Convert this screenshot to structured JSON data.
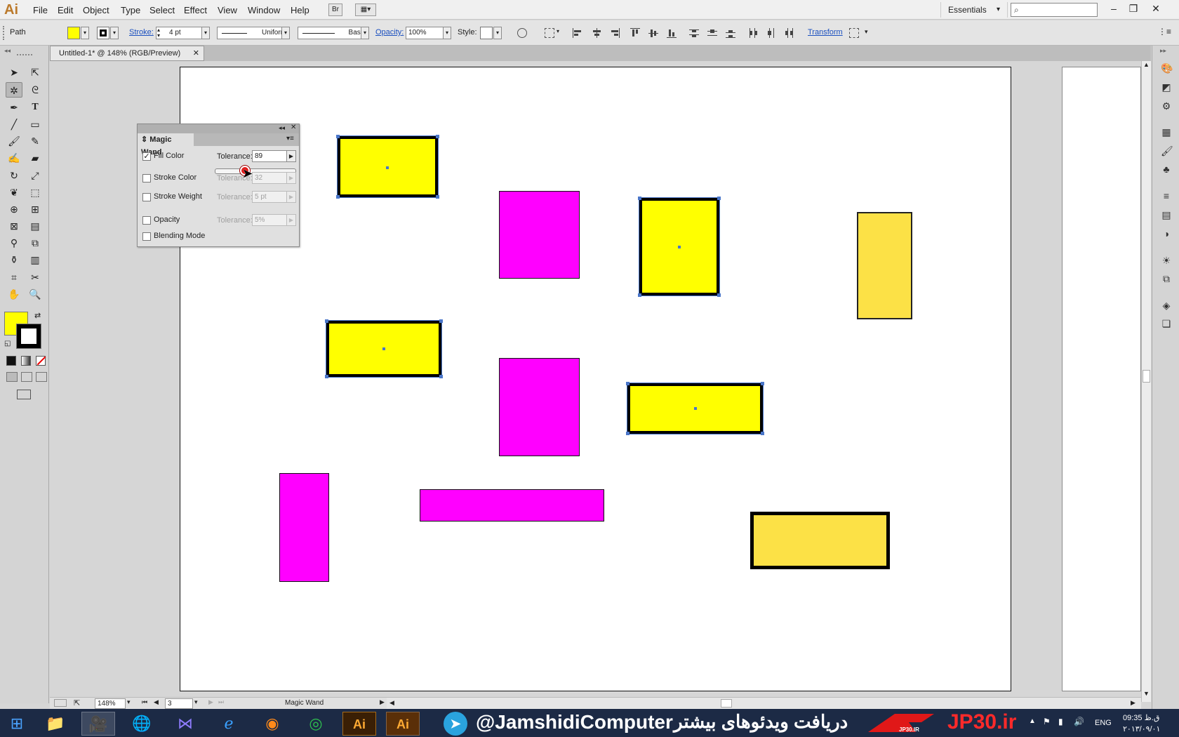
{
  "app": {
    "logo": "Ai"
  },
  "menu": [
    "File",
    "Edit",
    "Object",
    "Type",
    "Select",
    "Effect",
    "View",
    "Window",
    "Help"
  ],
  "menubar": {
    "bridge_btn": "Br",
    "workspace": "Essentials"
  },
  "control_bar": {
    "selection_type": "Path",
    "stroke_label": "Stroke:",
    "stroke_weight": "4 pt",
    "profile": "Uniform",
    "brush": "Basic",
    "opacity_label": "Opacity:",
    "opacity_value": "100%",
    "style_label": "Style:",
    "transform_link": "Transform",
    "fill_color": "#ffff00"
  },
  "document_tab": {
    "title": "Untitled-1* @ 148% (RGB/Preview)",
    "close": "✕"
  },
  "magic_wand": {
    "title": "Magic Wand",
    "rows": [
      {
        "label": "Fill Color",
        "checked": true,
        "tolerance_label": "Tolerance:",
        "tolerance": "89",
        "enabled": true
      },
      {
        "label": "Stroke Color",
        "checked": false,
        "tolerance_label": "Tolerance:",
        "tolerance": "32",
        "enabled": false
      },
      {
        "label": "Stroke Weight",
        "checked": false,
        "tolerance_label": "Tolerance:",
        "tolerance": "5 pt",
        "enabled": false
      },
      {
        "label": "Opacity",
        "checked": false,
        "tolerance_label": "Tolerance:",
        "tolerance": "5%",
        "enabled": false
      },
      {
        "label": "Blending Mode",
        "checked": false
      }
    ],
    "slider_fraction": 0.35
  },
  "colors": {
    "yellow": "#ffff00",
    "gold": "#fce146",
    "magenta": "#ff00ff",
    "selection": "#4a76c9"
  },
  "status_bar": {
    "zoom": "148%",
    "artboard": "3",
    "current_tool": "Magic Wand"
  },
  "taskbar": {
    "watermark_handle": "@JamshidiComputer",
    "watermark_fa": "دریافت ویدئوهای بیشتر",
    "watermark_site": "JP30.ir",
    "watermark_logo_text": "JP30.IR",
    "language": "ENG",
    "time": "09:35 ق.ظ",
    "date": "۲۰۱۳/۰۹/۰۱"
  },
  "icons": {
    "tools": [
      "selection-icon",
      "direct-selection-icon",
      "magic-wand-icon",
      "lasso-icon",
      "pen-icon",
      "type-icon",
      "line-icon",
      "rectangle-icon",
      "paintbrush-icon",
      "pencil-icon",
      "blob-brush-icon",
      "eraser-icon",
      "rotate-icon",
      "scale-icon",
      "warp-icon",
      "free-transform-icon",
      "shape-builder-icon",
      "perspective-grid-icon",
      "mesh-icon",
      "gradient-icon",
      "eyedropper-icon",
      "blend-icon",
      "symbol-sprayer-icon",
      "column-graph-icon",
      "artboard-icon",
      "slice-icon",
      "hand-icon",
      "zoom-icon"
    ]
  }
}
